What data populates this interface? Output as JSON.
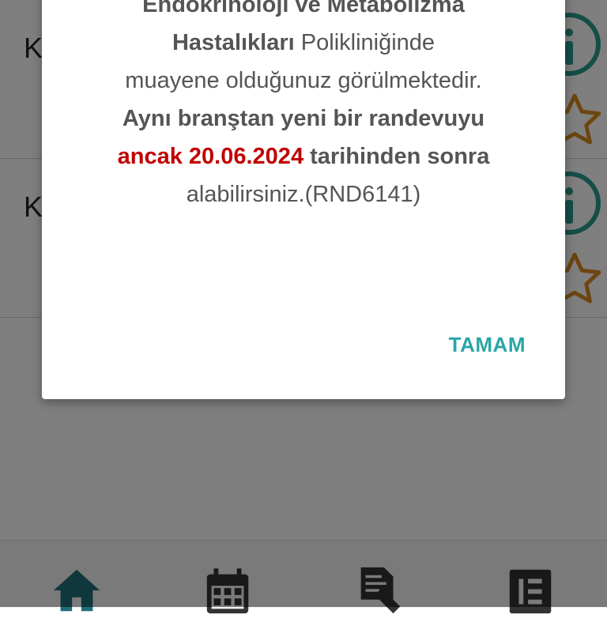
{
  "list": {
    "items": [
      {
        "label": "K",
        "info_icon": "info-icon",
        "star_icon": "star-outline-icon"
      },
      {
        "label": "K",
        "info_icon": "info-icon",
        "star_icon": "star-outline-icon"
      }
    ]
  },
  "dialog": {
    "line1": "Endokrinoloji ve Metabolizma",
    "line2_bold": "Hastalıkları",
    "line2_rest": " Polikliniğinde",
    "line3": "muayene olduğunuz görülmektedir.",
    "line4": "Aynı branştan yeni bir randevuyu",
    "line5_red": "ancak 20.06.2024",
    "line5_rest": " tarihinden sonra",
    "line6": "alabilirsiniz.(RND6141)",
    "ok_label": "TAMAM"
  },
  "bottom_nav": {
    "items": [
      {
        "icon": "home-icon",
        "color": "#1f6f78"
      },
      {
        "icon": "calendar-icon",
        "color": "#333333"
      },
      {
        "icon": "document-icon",
        "color": "#333333"
      },
      {
        "icon": "list-icon",
        "color": "#333333"
      }
    ]
  },
  "colors": {
    "accent": "#2aa6a6",
    "warning": "#c00000",
    "icon_teal": "#2a9d8f",
    "star": "#d98b1e"
  }
}
